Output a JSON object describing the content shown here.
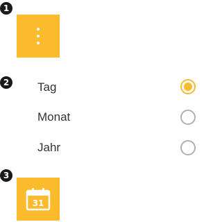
{
  "steps": {
    "step1": "1",
    "step2": "2",
    "step3": "3"
  },
  "menu_button": {
    "icon": "more-vertical-icon"
  },
  "period_options": [
    {
      "label": "Tag",
      "selected": true
    },
    {
      "label": "Monat",
      "selected": false
    },
    {
      "label": "Jahr",
      "selected": false
    }
  ],
  "calendar_button": {
    "icon": "calendar-icon",
    "day": "31"
  },
  "colors": {
    "accent": "#fbbb2d",
    "badge": "#1a1a1a",
    "text": "#333333",
    "radio_border": "#b0b0b0"
  }
}
